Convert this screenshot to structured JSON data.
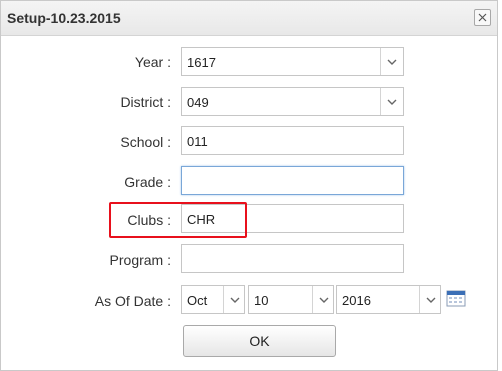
{
  "dialog": {
    "title": "Setup-10.23.2015",
    "fields": {
      "year": {
        "label": "Year :",
        "value": "1617"
      },
      "district": {
        "label": "District :",
        "value": "049"
      },
      "school": {
        "label": "School :",
        "value": "011"
      },
      "grade": {
        "label": "Grade :",
        "value": ""
      },
      "clubs": {
        "label": "Clubs :",
        "value": "CHR"
      },
      "program": {
        "label": "Program :",
        "value": ""
      },
      "as_of_date": {
        "label": "As Of Date :",
        "month": "Oct",
        "day": "10",
        "year": "2016"
      }
    },
    "ok_label": "OK"
  },
  "colors": {
    "highlight": "#e8101c",
    "focus_border": "#7aa7d8",
    "calendar_icon": "#3b6fb6"
  },
  "icons": [
    "close-icon",
    "chevron-down-icon",
    "calendar-icon"
  ]
}
